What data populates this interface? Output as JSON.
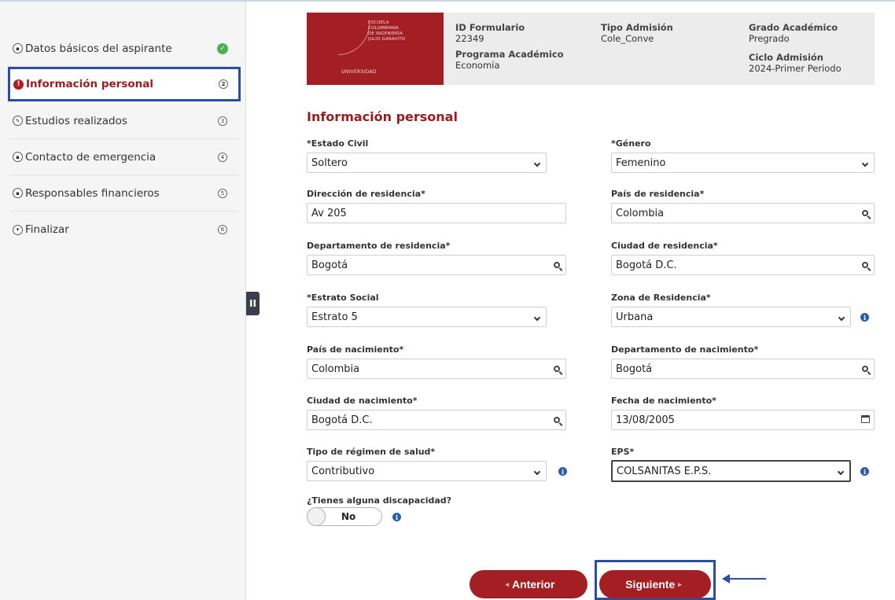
{
  "sidebar": {
    "steps": [
      {
        "label": "Datos básicos del aspirante",
        "icon": "id-card-icon",
        "status": "completed",
        "number": ""
      },
      {
        "label": "Información personal",
        "icon": "alert-icon",
        "status": "current",
        "number": "2"
      },
      {
        "label": "Estudios realizados",
        "icon": "pencil-icon",
        "status": "pending",
        "number": "3"
      },
      {
        "label": "Contacto de emergencia",
        "icon": "contact-icon",
        "status": "pending",
        "number": "4"
      },
      {
        "label": "Responsables financieros",
        "icon": "money-icon",
        "status": "pending",
        "number": "5"
      },
      {
        "label": "Finalizar",
        "icon": "finish-icon",
        "status": "pending",
        "number": "6"
      }
    ],
    "collapse_glyph": "II"
  },
  "header": {
    "logo": {
      "line1": "ESCUELA",
      "line2": "COLOMBIANA",
      "line3": "DE INGENIERÍA",
      "line4": "JULIO GARAVITO",
      "bottom": "UNIVERSIDAD"
    },
    "id_formulario_label": "ID Formulario",
    "id_formulario_value": "22349",
    "programa_label": "Programa Académico",
    "programa_value": "Economía",
    "tipo_admision_label": "Tipo Admisión",
    "tipo_admision_value": "Cole_Conve",
    "grado_label": "Grado Académico",
    "grado_value": "Pregrado",
    "ciclo_label": "Ciclo Admisión",
    "ciclo_value": "2024-Primer Periodo"
  },
  "form": {
    "title": "Información personal",
    "estado_civil": {
      "label": "*Estado Civil",
      "value": "Soltero"
    },
    "genero": {
      "label": "*Género",
      "value": "Femenino"
    },
    "direccion": {
      "label": "Dirección de residencia*",
      "value": "Av 205"
    },
    "pais_residencia": {
      "label": "País de residencia*",
      "value": "Colombia"
    },
    "departamento_residencia": {
      "label": "Departamento de residencia*",
      "value": "Bogotá"
    },
    "ciudad_residencia": {
      "label": "Ciudad de residencia*",
      "value": "Bogotá D.C."
    },
    "estrato": {
      "label": "*Estrato Social",
      "value": "Estrato 5"
    },
    "zona": {
      "label": "Zona de Residencia*",
      "value": "Urbana"
    },
    "pais_nacimiento": {
      "label": "País de nacimiento*",
      "value": "Colombia"
    },
    "departamento_nacimiento": {
      "label": "Departamento de nacimiento*",
      "value": "Bogotá"
    },
    "ciudad_nacimiento": {
      "label": "Ciudad de nacimiento*",
      "value": "Bogotá D.C."
    },
    "fecha_nacimiento": {
      "label": "Fecha de nacimiento*",
      "value": "13/08/2005"
    },
    "regimen_salud": {
      "label": "Tipo de régimen de salud*",
      "value": "Contributivo"
    },
    "eps": {
      "label": "EPS*",
      "value": "COLSANITAS E.P.S."
    },
    "discapacidad": {
      "label": "¿Tienes alguna discapacidad?",
      "value": "No"
    }
  },
  "buttons": {
    "anterior": "Anterior",
    "siguiente": "Siguiente"
  },
  "colors": {
    "brand": "#a31f24",
    "highlight": "#2a4fa0",
    "success": "#4caf50",
    "info": "#2a5db0"
  }
}
